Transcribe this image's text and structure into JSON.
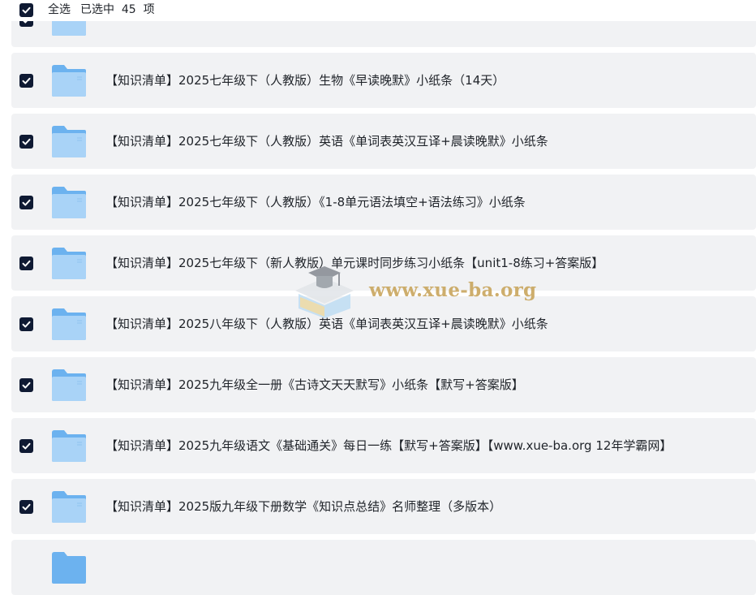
{
  "header": {
    "select_all_label": "全选",
    "selected_text": "已选中  45  项"
  },
  "items": [
    {
      "label": "【知识清单】2025七年级下（人教版）生物《早读晚默》小纸条（14天）"
    },
    {
      "label": "【知识清单】2025七年级下（人教版）英语《单词表英汉互译+晨读晚默》小纸条"
    },
    {
      "label": "【知识清单】2025七年级下（人教版）《1-8单元语法填空+语法练习》小纸条"
    },
    {
      "label": "【知识清单】2025七年级下（新人教版）单元课时同步练习小纸条【unit1-8练习+答案版】"
    },
    {
      "label": "【知识清单】2025八年级下（人教版）英语《单词表英汉互译+晨读晚默》小纸条"
    },
    {
      "label": "【知识清单】2025九年级全一册《古诗文天天默写》小纸条【默写+答案版】"
    },
    {
      "label": "【知识清单】2025九年级语文《基础通关》每日一练【默写+答案版】【www.xue-ba.org 12年学霸网】"
    },
    {
      "label": "【知识清单】2025版九年级下册数学《知识点总结》名师整理（多版本）"
    }
  ],
  "watermark": {
    "text": "www.xue-ba.org"
  },
  "colors": {
    "checkbox": "#0f1a33",
    "row_bg": "#f1f2f4",
    "folder_light": "#a9d3f7",
    "folder_dark": "#6cb2ef",
    "watermark": "#c9a65e"
  }
}
